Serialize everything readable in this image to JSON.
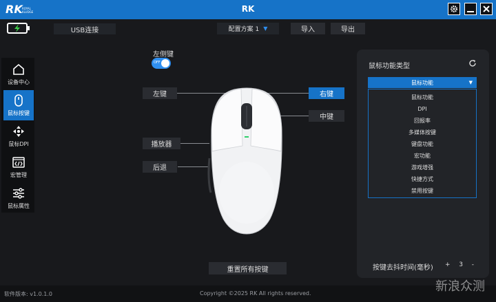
{
  "app": {
    "title": "RK"
  },
  "topbar": {
    "connection": "USB连接",
    "profile_label": "配置方案 1",
    "import_label": "导入",
    "export_label": "导出"
  },
  "sidebar": {
    "items": [
      {
        "label": "设备中心",
        "icon": "home-icon",
        "active": false
      },
      {
        "label": "鼠标按键",
        "icon": "mouse-icon",
        "active": true
      },
      {
        "label": "鼠标DPI",
        "icon": "dpi-icon",
        "active": false
      },
      {
        "label": "宏管理",
        "icon": "macro-icon",
        "active": false
      },
      {
        "label": "鼠标属性",
        "icon": "sliders-icon",
        "active": false
      }
    ]
  },
  "mouse_view": {
    "side_key_label": "左侧键",
    "toggle_text": "OFF",
    "buttons": {
      "left": "左键",
      "right": "右键",
      "middle": "中键",
      "play": "播放器",
      "back": "后退"
    },
    "reset_label": "重置所有按键"
  },
  "panel": {
    "title": "鼠标功能类型",
    "selected": "鼠标功能",
    "options": [
      "鼠标功能",
      "DPI",
      "回报率",
      "多媒体按键",
      "键盘功能",
      "宏功能",
      "游戏增强",
      "快捷方式",
      "禁用按键"
    ],
    "debounce_label": "按键去抖时间(毫秒)",
    "debounce_value": "3",
    "minus": "-",
    "plus": "+"
  },
  "footer": {
    "version": "软件版本: v1.0.1.0",
    "copyright": "Copyright ©2025 RK All rights reserved."
  },
  "watermark": {
    "text": "新浪众测"
  },
  "colors": {
    "accent": "#1673c8",
    "bg": "#18191c",
    "panel": "#222428"
  }
}
